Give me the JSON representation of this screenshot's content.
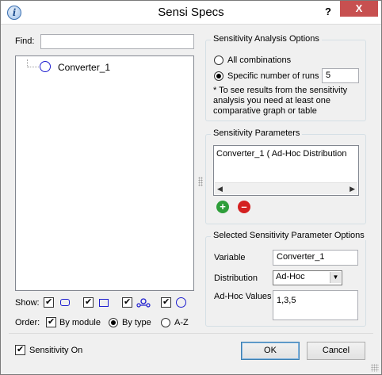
{
  "window": {
    "title": "Sensi Specs",
    "help_label": "?",
    "close_label": "X"
  },
  "find": {
    "label": "Find:",
    "value": ""
  },
  "tree": {
    "items": [
      {
        "label": "Converter_1",
        "icon": "converter-circle-icon"
      }
    ]
  },
  "show": {
    "label": "Show:",
    "filters": [
      {
        "checked": true,
        "icon": "stock-rounded-rect-icon"
      },
      {
        "checked": true,
        "icon": "module-rect-icon"
      },
      {
        "checked": true,
        "icon": "flow-icon"
      },
      {
        "checked": true,
        "icon": "converter-circle-icon"
      }
    ]
  },
  "order": {
    "label": "Order:",
    "by_module_label": "By module",
    "by_module_checked": true,
    "by_type_label": "By type",
    "az_label": "A-Z",
    "selected": "By type"
  },
  "sensitivity_on": {
    "label": "Sensitivity On",
    "checked": true
  },
  "analysis_options": {
    "title": "Sensitivity Analysis Options",
    "all_combinations_label": "All combinations",
    "specific_runs_label": "Specific number of runs",
    "selected": "Specific number of runs",
    "runs_value": "5",
    "note": "* To see results from the sensitivity analysis you need at least one comparative graph or table"
  },
  "parameters": {
    "title": "Sensitivity Parameters",
    "items": [
      "Converter_1 ( Ad-Hoc Distribution"
    ],
    "add_icon": "add-icon",
    "remove_icon": "remove-icon"
  },
  "selected_options": {
    "title": "Selected Sensitivity Parameter Options",
    "variable_label": "Variable",
    "variable_value": "Converter_1",
    "distribution_label": "Distribution",
    "distribution_value": "Ad-Hoc",
    "adhoc_label": "Ad-Hoc Values",
    "adhoc_value": "1,3,5"
  },
  "buttons": {
    "ok": "OK",
    "cancel": "Cancel"
  },
  "colors": {
    "accent_blue": "#1e1ecf",
    "add_green": "#2e9e3a",
    "remove_red": "#d42020",
    "close_red": "#c75050"
  }
}
